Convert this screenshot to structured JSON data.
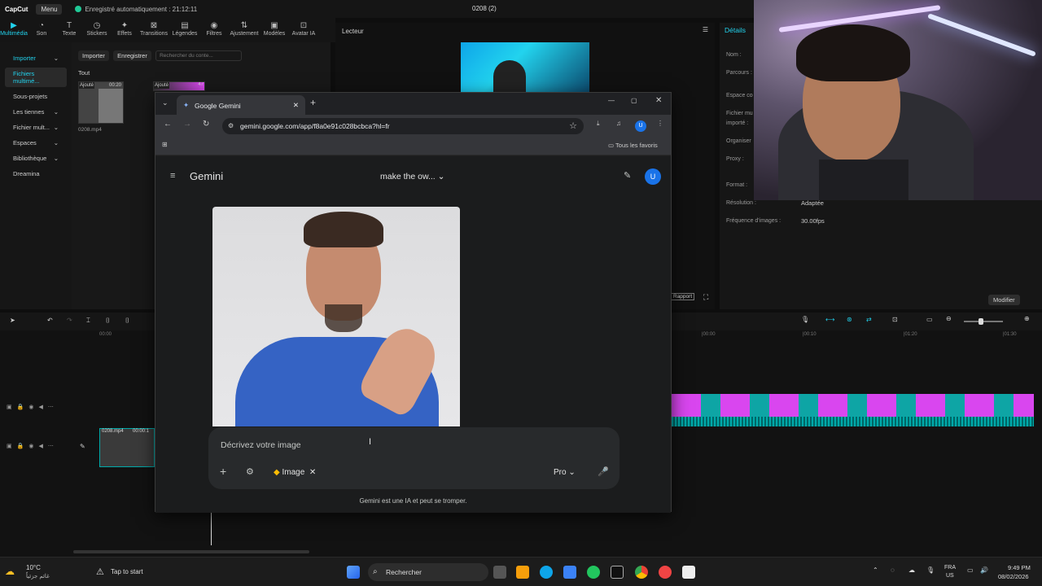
{
  "app": {
    "logo": "CapCut",
    "menu": "Menu",
    "autosave": "Enregistré automatiquement : 21:12:11",
    "doc_title": "0208 (2)"
  },
  "toolbar": {
    "items": [
      "Multimédia",
      "Son",
      "Texte",
      "Stickers",
      "Effets",
      "Transitions",
      "Légendes",
      "Filtres",
      "Ajustement",
      "Modèles",
      "Avatar IA"
    ]
  },
  "leftnav": {
    "items": [
      "Importer",
      "Fichiers multimé...",
      "Sous-projets",
      "Les tiennes",
      "Fichier mult...",
      "Espaces",
      "Bibliothèque",
      "Dreamina"
    ]
  },
  "media": {
    "import_btn": "Importer",
    "record_btn": "Enregistrer",
    "search_placeholder": "Rechercher du conte...",
    "tab_all": "Tout",
    "thumb1_badge": "Ajouté",
    "thumb1_duration": "00:20",
    "thumb1_name": "0208.mp4",
    "thumb2_badge": "Ajouté",
    "thumb2_duration": "47"
  },
  "player": {
    "title": "Lecteur",
    "rapport": "Rapport"
  },
  "details": {
    "title": "Détails",
    "rows": [
      "Nom :",
      "Parcours :",
      "Espace co",
      "Fichier mu",
      "importé :",
      "Organiser",
      "Proxy :",
      "Format :",
      "Résolution :",
      "Fréquence d'images :"
    ],
    "res_value": "Adaptée",
    "fps_value": "30.00fps",
    "modify": "Modifier"
  },
  "timeline": {
    "t0": "00:00",
    "t1": "|00:00",
    "t2": "|00:10",
    "t3": "|01:20",
    "t4": "|01:30",
    "clip_name": "0208.mp4",
    "clip_dur": "00:00:1"
  },
  "chrome": {
    "tab_title": "Google Gemini",
    "url": "gemini.google.com/app/f8a0e91c028bcbca?hl=fr",
    "bookmarks_all": "Tous les favoris"
  },
  "gemini": {
    "brand": "Gemini",
    "conversation": "make the ow...",
    "avatar": "U",
    "placeholder": "Décrivez votre image",
    "chip": "Image",
    "mode": "Pro",
    "disclaimer": "Gemini est une IA et peut se tromper."
  },
  "taskbar": {
    "temp": "10°C",
    "weather": "غائم جزئياً",
    "tap": "Tap to start",
    "search": "Rechercher",
    "lang1": "FRA",
    "lang2": "US",
    "time": "9:49 PM",
    "date": "08/02/2026"
  }
}
